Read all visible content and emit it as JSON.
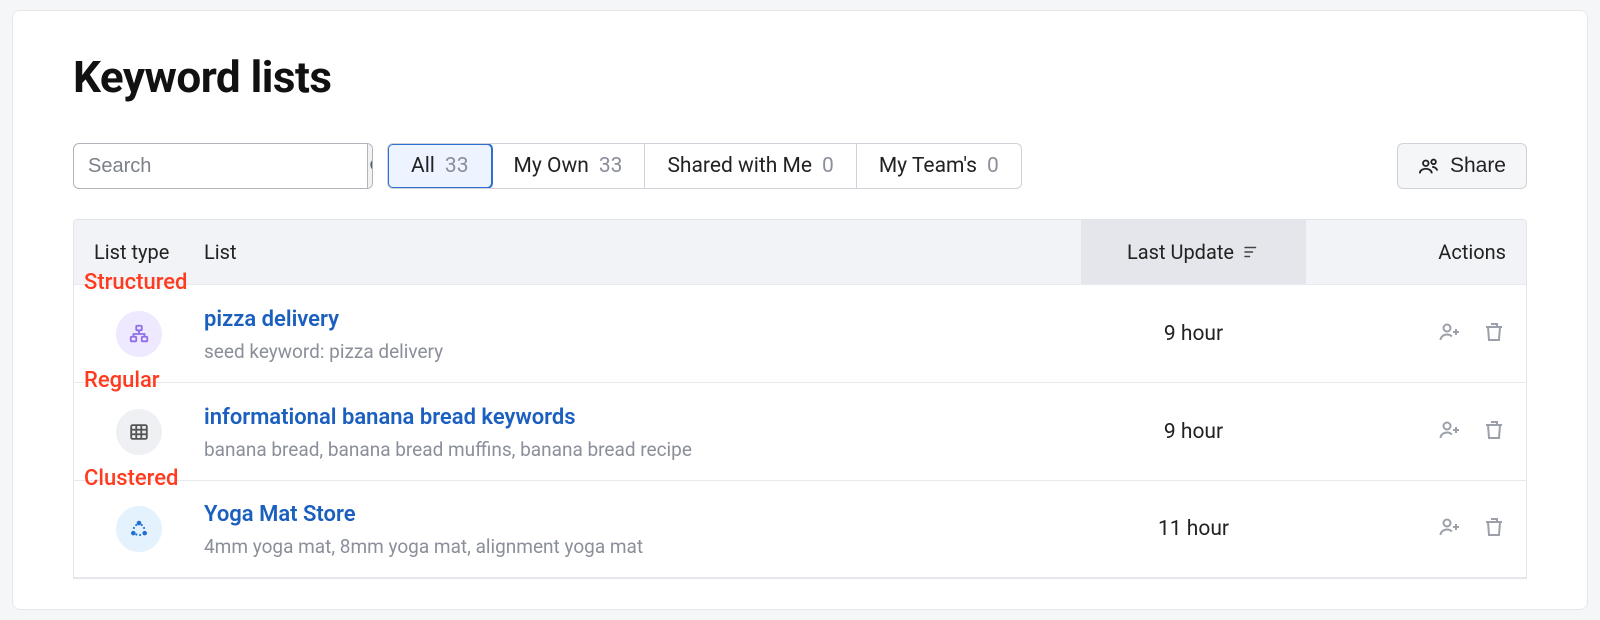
{
  "page_title": "Keyword lists",
  "search": {
    "placeholder": "Search"
  },
  "tabs": [
    {
      "label": "All",
      "count": "33",
      "active": true
    },
    {
      "label": "My Own",
      "count": "33",
      "active": false
    },
    {
      "label": "Shared with Me",
      "count": "0",
      "active": false
    },
    {
      "label": "My Team's",
      "count": "0",
      "active": false
    }
  ],
  "share_label": "Share",
  "columns": {
    "list_type": "List type",
    "list": "List",
    "update": "Last Update",
    "actions": "Actions"
  },
  "rows": [
    {
      "annotation": "Structured",
      "type": "structured",
      "name": "pizza delivery",
      "subtitle": "seed keyword: pizza delivery",
      "updated": "9 hour"
    },
    {
      "annotation": "Regular",
      "type": "regular",
      "name": "informational banana bread keywords",
      "subtitle": "banana bread, banana bread muffins, banana bread recipe",
      "updated": "9 hour"
    },
    {
      "annotation": "Clustered",
      "type": "clustered",
      "name": "Yoga Mat Store",
      "subtitle": "4mm yoga mat, 8mm yoga mat, alignment yoga mat",
      "updated": "11 hour"
    }
  ]
}
